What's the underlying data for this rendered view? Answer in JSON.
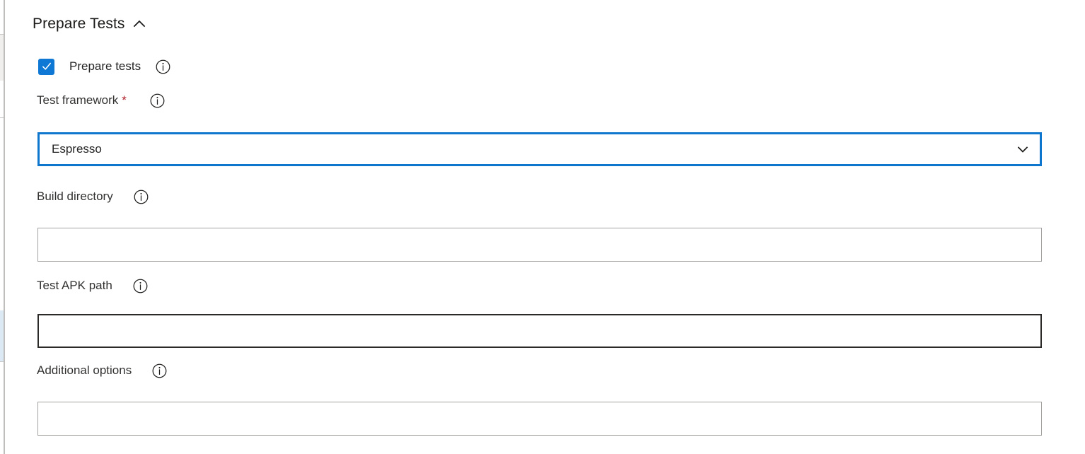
{
  "section": {
    "title": "Prepare Tests",
    "collapse_icon": "chevron-up-icon",
    "expanded": true
  },
  "checkbox": {
    "label": "Prepare tests",
    "checked": true,
    "check_icon": "checkmark-icon",
    "info_icon": "info-icon",
    "accent_color": "#0f77d4"
  },
  "fields": [
    {
      "label": "Test framework",
      "required": true,
      "required_marker": "*",
      "required_color": "#b0202c",
      "info_icon": "info-icon",
      "control": "dropdown",
      "value": "Espresso",
      "placeholder": "",
      "focused": true,
      "chevron_icon": "chevron-down-icon",
      "focus_border_color": "#0f76cd"
    },
    {
      "label": "Build directory",
      "required": false,
      "required_marker": "",
      "info_icon": "info-icon",
      "control": "textbox",
      "value": "",
      "placeholder": "",
      "focused": false,
      "border_color": "#a3a2a0"
    },
    {
      "label": "Test APK path",
      "required": false,
      "required_marker": "",
      "info_icon": "info-icon",
      "control": "textbox",
      "value": "",
      "placeholder": "",
      "hovered": true,
      "border_color": "#2b2a29"
    },
    {
      "label": "Additional options",
      "required": false,
      "required_marker": "",
      "info_icon": "info-icon",
      "control": "textbox",
      "value": "",
      "placeholder": "",
      "focused": false,
      "border_color": "#a3a2a0"
    }
  ]
}
